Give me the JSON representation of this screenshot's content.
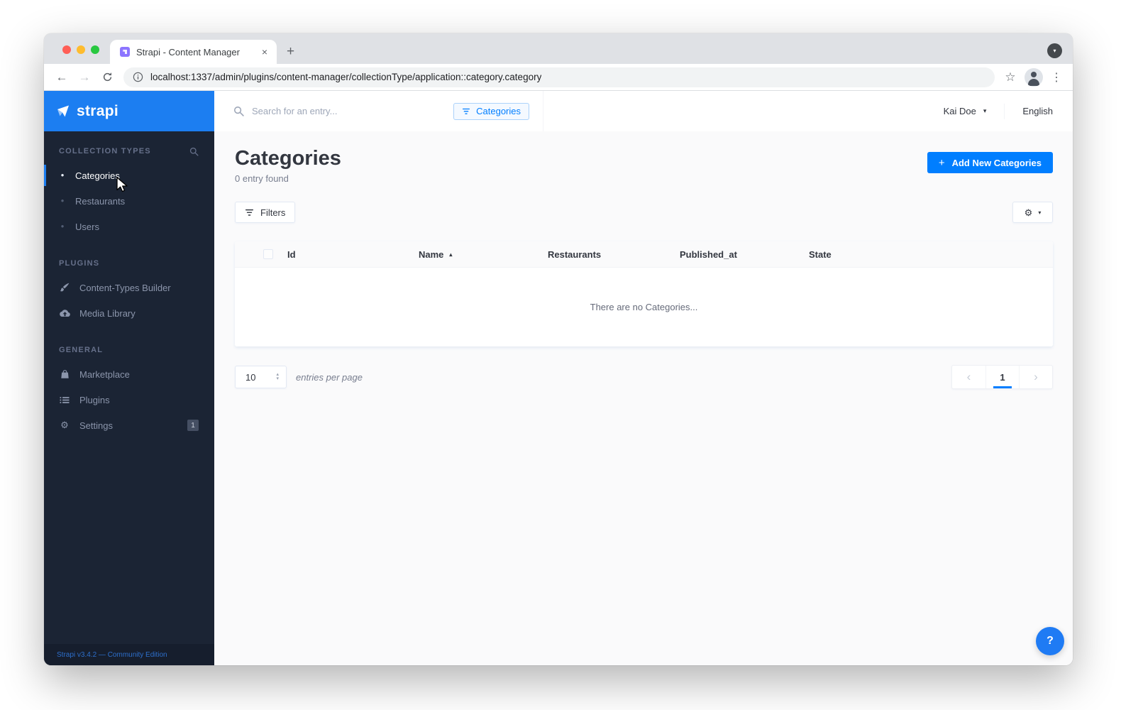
{
  "browser": {
    "tab_title": "Strapi - Content Manager",
    "url": "localhost:1337/admin/plugins/content-manager/collectionType/application::category.category"
  },
  "header": {
    "search_placeholder": "Search for an entry...",
    "filter_chip": "Categories",
    "user_name": "Kai Doe",
    "language": "English"
  },
  "sidebar": {
    "logo_text": "strapi",
    "sections": [
      {
        "title": "COLLECTION TYPES",
        "items": [
          {
            "label": "Categories",
            "active": true
          },
          {
            "label": "Restaurants"
          },
          {
            "label": "Users"
          }
        ]
      },
      {
        "title": "PLUGINS",
        "items": [
          {
            "label": "Content-Types Builder"
          },
          {
            "label": "Media Library"
          }
        ]
      },
      {
        "title": "GENERAL",
        "items": [
          {
            "label": "Marketplace"
          },
          {
            "label": "Plugins"
          },
          {
            "label": "Settings",
            "badge": "1"
          }
        ]
      }
    ],
    "footer": "Strapi v3.4.2 — Community Edition"
  },
  "main": {
    "title": "Categories",
    "subtitle": "0 entry found",
    "add_button_label": "Add New Categories",
    "filters_button_label": "Filters",
    "table": {
      "columns": [
        "Id",
        "Name",
        "Restaurants",
        "Published_at",
        "State"
      ],
      "sorted_column": "Name",
      "sort_direction": "asc",
      "empty_message": "There are no Categories..."
    },
    "pagination": {
      "per_page": "10",
      "per_page_label": "entries per page",
      "current_page": "1"
    },
    "help_label": "?"
  },
  "icons": {
    "close": "×",
    "plus": "+",
    "back": "←",
    "forward": "→",
    "star": "☆",
    "menu_dots": "⋮",
    "caret_down": "▾",
    "sort_asc": "▴",
    "stepper_up": "▴",
    "stepper_down": "▾",
    "chevron_left": "‹",
    "chevron_right": "›",
    "gear": "⚙",
    "bullet": "•"
  },
  "colors": {
    "brand_blue": "#007eff",
    "logo_bar_blue": "#1c7ef1",
    "sidebar_dark": "#1b2434",
    "traffic_close": "#ff5f57",
    "traffic_minimize": "#febc2e",
    "traffic_zoom": "#28c840"
  }
}
